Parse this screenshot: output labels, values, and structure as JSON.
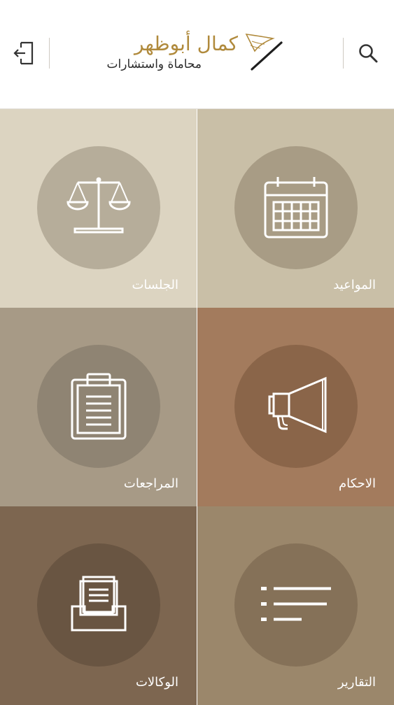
{
  "header": {
    "logo_title": "كمال أبوظهر",
    "logo_subtitle": "محاماة واستشارات",
    "logout_icon": "logout-icon",
    "search_icon": "search-icon"
  },
  "tiles": [
    {
      "label": "المواعيد",
      "icon": "calendar-icon",
      "bg": "#c9bfa7",
      "circle": "#a89c85"
    },
    {
      "label": "الجلسات",
      "icon": "scales-icon",
      "bg": "#dcd4c1",
      "circle": "#b6ad9a"
    },
    {
      "label": "الاحكام",
      "icon": "megaphone-icon",
      "bg": "#a37b5d",
      "circle": "#8a6549"
    },
    {
      "label": "المراجعات",
      "icon": "clipboard-icon",
      "bg": "#a79a86",
      "circle": "#8f8473"
    },
    {
      "label": "التقارير",
      "icon": "list-icon",
      "bg": "#9b876b",
      "circle": "#857158"
    },
    {
      "label": "الوكالات",
      "icon": "archive-box-icon",
      "bg": "#7d6650",
      "circle": "#695542"
    }
  ]
}
